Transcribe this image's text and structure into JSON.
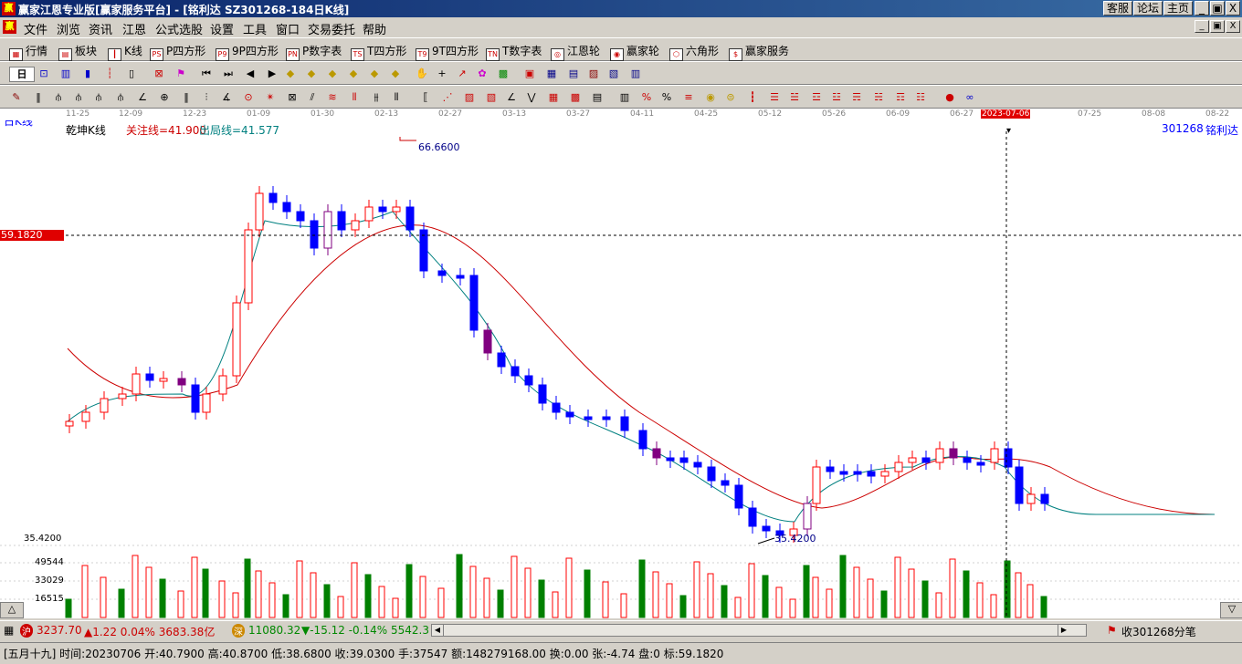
{
  "window": {
    "title": "赢家江恩专业版[赢家服务平台] - [铭利达  SZ301268-184日K线]",
    "logo": "赢",
    "btn_service": "客服",
    "btn_forum": "论坛",
    "btn_home": "主页",
    "minimize": "_",
    "restore": "▣",
    "close": "X"
  },
  "menu": {
    "items": [
      "文件",
      "浏览",
      "资讯",
      "江恩",
      "公式选股",
      "设置",
      "工具",
      "窗口",
      "交易委托",
      "帮助"
    ]
  },
  "toolbar1": {
    "items": [
      "行情",
      "板块",
      "K线",
      "P四方形",
      "9P四方形",
      "P数字表",
      "T四方形",
      "9T四方形",
      "T数字表",
      "江恩轮",
      "赢家轮",
      "六角形",
      "赢家服务"
    ]
  },
  "toolbar2": {
    "period": "日"
  },
  "dates": {
    "labels": [
      "11-25",
      "12-09",
      "12-23",
      "01-09",
      "01-30",
      "02-13",
      "02-27",
      "03-13",
      "03-27",
      "04-11",
      "04-25",
      "05-12",
      "05-26",
      "06-09",
      "06-27",
      "2023-07-06",
      "07-25",
      "08-08",
      "08-22"
    ],
    "selected": "2023-07-06"
  },
  "chart": {
    "period_label": "日K线",
    "indicator_name": "乾坤K线",
    "attention_line": "关注线=41.900",
    "exit_line": "出局线=41.577",
    "stock_code": "301268",
    "stock_name": "铭利达",
    "high_label": "66.6600",
    "low_label": "35.4200",
    "price_marker": "59.1820",
    "axis_low": "35.4200",
    "vol_labels": [
      "49544",
      "33029",
      "16515"
    ]
  },
  "chart_data": {
    "type": "bar",
    "title": "乾坤K线",
    "price_range": [
      35.42,
      66.66
    ],
    "crosshair_price": 59.182,
    "crosshair_date": "2023-07-06",
    "indicators": [
      {
        "name": "关注线",
        "value": 41.9
      },
      {
        "name": "出局线",
        "value": 41.577
      }
    ],
    "volume_ticks": [
      16515,
      33029,
      49544
    ],
    "colors": {
      "up": "#ff0000",
      "down": "#0000ff",
      "neutral": "#800080",
      "volume_up": "#ff0000",
      "volume_down": "#008000",
      "ma_slow": "#cc0000",
      "ma_fast": "#008080"
    }
  },
  "status": {
    "sh_label": "沪",
    "sh_index": "3237.70",
    "sh_change": "▲1.22 0.04% 3683.38亿",
    "sz_label": "深",
    "sz_index": "11080.32",
    "sz_change": "▼-15.12 -0.14% 5542.3",
    "right_text": "收301268分笔",
    "info": "[五月十九] 时间:20230706 开:40.7900 高:40.8700 低:38.6800 收:39.0300 手:37547 额:148279168.00 换:0.00 张:-4.74 盘:0 标:59.1820"
  }
}
